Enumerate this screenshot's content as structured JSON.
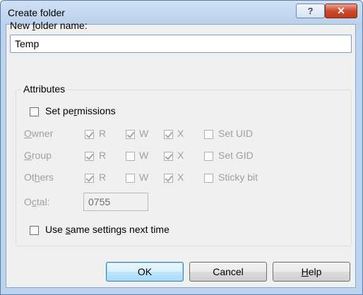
{
  "window": {
    "title": "Create folder",
    "help_glyph": "?",
    "close_glyph": "✕"
  },
  "name": {
    "label_before": "New ",
    "label_accel": "f",
    "label_after": "older name:",
    "value": "Temp"
  },
  "attributes": {
    "title": "Attributes",
    "set_permissions": {
      "before": "Set pe",
      "accel": "r",
      "after": "missions",
      "checked": false
    },
    "rows": [
      {
        "label_before": "",
        "label_accel": "O",
        "label_after": "wner",
        "r": true,
        "w": true,
        "x": true,
        "extra_label": "Set UID",
        "extra_checked": false
      },
      {
        "label_before": "",
        "label_accel": "G",
        "label_after": "roup",
        "r": true,
        "w": false,
        "x": true,
        "extra_label": "Set GID",
        "extra_checked": false
      },
      {
        "label_before": "Ot",
        "label_accel": "h",
        "label_after": "ers",
        "r": true,
        "w": false,
        "x": true,
        "extra_label": "Sticky bit",
        "extra_checked": false
      }
    ],
    "col_r": "R",
    "col_w": "W",
    "col_x": "X",
    "octal": {
      "label_before": "O",
      "label_accel": "c",
      "label_after": "tal:",
      "value": "0755"
    }
  },
  "use_same": {
    "before": "Use ",
    "accel": "s",
    "after": "ame settings next time",
    "checked": false
  },
  "buttons": {
    "ok": "OK",
    "cancel": "Cancel",
    "help_accel": "H",
    "help_rest": "elp"
  }
}
